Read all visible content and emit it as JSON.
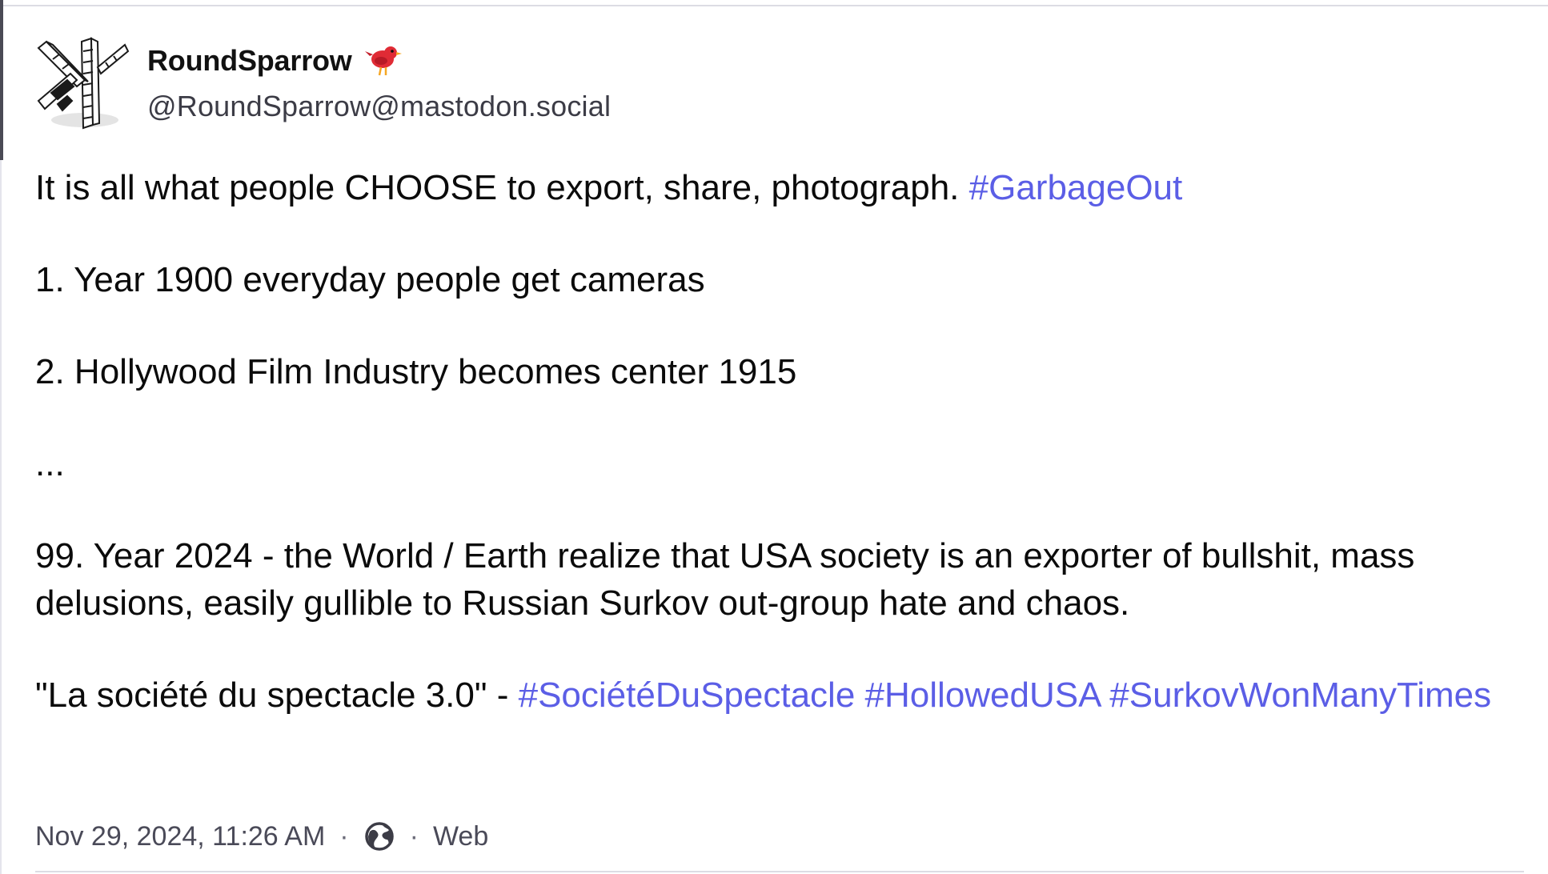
{
  "account": {
    "display_name": "RoundSparrow",
    "handle": "@RoundSparrow@mastodon.social",
    "avatar_icon": "wireframe-sticks-icon",
    "emoji_icon": "red-bird-icon"
  },
  "post": {
    "paragraphs": [
      [
        {
          "text": "It is all what people CHOOSE to export, share, photograph. ",
          "tag": false
        },
        {
          "text": "#GarbageOut",
          "tag": true
        }
      ],
      [
        {
          "text": "1. Year 1900 everyday people get cameras",
          "tag": false
        }
      ],
      [
        {
          "text": "2. Hollywood Film Industry becomes center 1915",
          "tag": false
        }
      ],
      [
        {
          "text": "...",
          "tag": false
        }
      ],
      [
        {
          "text": "99. Year 2024 - the World / Earth realize that USA society is an exporter of bullshit, mass delusions, easily gullible to Russian Surkov out-group hate and chaos.",
          "tag": false
        }
      ],
      [
        {
          "text": "\"La société du spectacle 3.0\" - ",
          "tag": false
        },
        {
          "text": "#SociétéDuSpectacle",
          "tag": true
        },
        {
          "text": " ",
          "tag": false
        },
        {
          "text": "#HollowedUSA",
          "tag": true
        },
        {
          "text": " ",
          "tag": false
        },
        {
          "text": "#SurkovWonManyTimes",
          "tag": true
        }
      ]
    ]
  },
  "meta": {
    "timestamp": "Nov 29, 2024, 11:26 AM",
    "separator": "·",
    "visibility_icon": "globe-icon",
    "application": "Web"
  },
  "colors": {
    "hashtag": "#5b5ee6",
    "text": "#0b0b0b",
    "muted": "#4a4a58"
  }
}
